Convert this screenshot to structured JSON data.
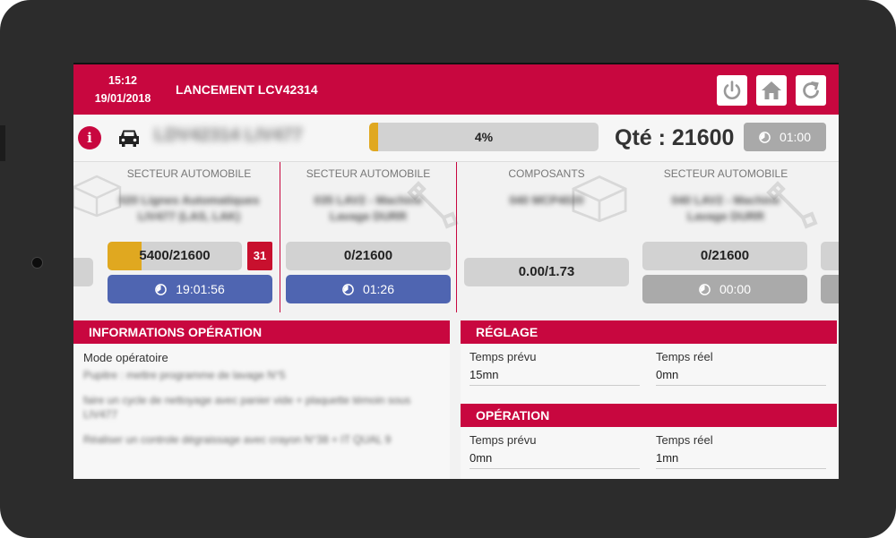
{
  "header": {
    "time": "15:12",
    "date": "19/01/2018",
    "title": "LANCEMENT LCV42314",
    "icons": [
      "power-icon",
      "home-icon",
      "refresh-icon"
    ]
  },
  "infobar": {
    "product_name": "LDV42314 LIV477",
    "progress_value": 0.04,
    "progress_label": "4%",
    "qty_label": "Qté : 21600",
    "timer": "01:00"
  },
  "cards": [
    {
      "category": "SECTEUR AUTOMOBILE",
      "name": "020 Lignes Automatiques LIV477 (LAS, LAK)",
      "qty": "5400/21600",
      "fill": 0.25,
      "badge": "31",
      "timer": "19:01:56",
      "timer_style": "blue"
    },
    {
      "category": "SECTEUR AUTOMOBILE",
      "name": "035 LAV2 - Machine Lavage DURR",
      "qty": "0/21600",
      "timer": "01:26",
      "timer_style": "blue"
    },
    {
      "category": "COMPOSANTS",
      "name": "040 MCP4020",
      "qty": "0.00/1.73"
    },
    {
      "category": "SECTEUR AUTOMOBILE",
      "name": "040 LAV2 - Machine Lavage DURR",
      "qty": "0/21600",
      "timer": "00:00",
      "timer_style": "grey"
    }
  ],
  "info_panel": {
    "title": "INFORMATIONS OPÉRATION",
    "mode_label": "Mode opératoire",
    "lines": [
      "Pupitre : mettre programme de lavage N°5",
      "faire un cycle de nettoyage avec panier vide + plaquette témoin sous LIV477",
      "Réaliser un controle dégraissage avec crayon N°38 + IT QUAL 9"
    ]
  },
  "reglage": {
    "title": "RÉGLAGE",
    "prevu_label": "Temps prévu",
    "prevu_value": "15mn",
    "reel_label": "Temps réel",
    "reel_value": "0mn"
  },
  "operation": {
    "title": "OPÉRATION",
    "prevu_label": "Temps prévu",
    "prevu_value": "0mn",
    "reel_label": "Temps réel",
    "reel_value": "1mn"
  },
  "colors": {
    "brand": "#c8073f",
    "progress": "#e0a820",
    "timer_blue": "#4f65b1"
  }
}
